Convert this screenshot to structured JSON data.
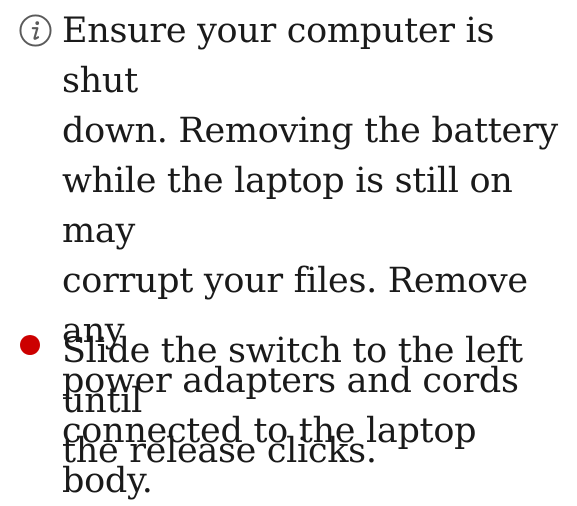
{
  "steps": [
    {
      "icon": "info-icon",
      "text": "Ensure your computer is shut\ndown. Removing the battery\nwhile the laptop is still on may\ncorrupt your files. Remove any\npower adapters and cords\nconnected to the laptop body."
    },
    {
      "icon": "bullet-dot-icon",
      "text": "Slide the switch to the left until\nthe release clicks."
    }
  ],
  "colors": {
    "text": "#1a1a1a",
    "info_icon": "#5a5a5a",
    "bullet": "#cc0000"
  }
}
